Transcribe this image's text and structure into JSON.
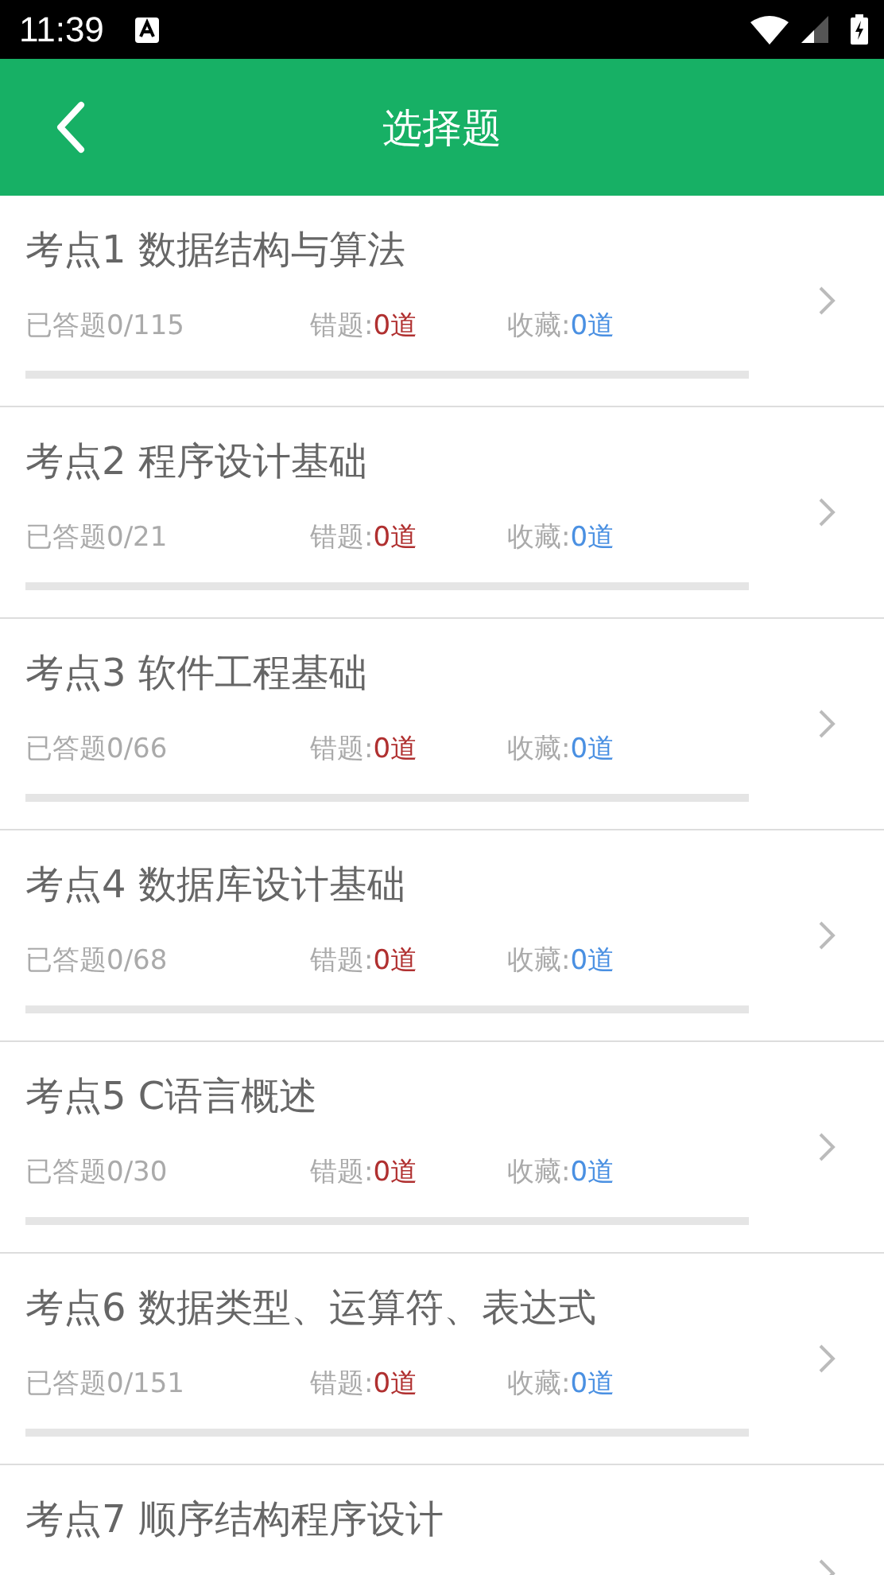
{
  "status_bar": {
    "time": "11:39"
  },
  "header": {
    "title": "选择题"
  },
  "topics": [
    {
      "title": "考点1 数据结构与算法",
      "answered": "已答题0/115",
      "wrong_label": "错题:",
      "wrong_count": "0道",
      "fav_label": "收藏:",
      "fav_count": "0道",
      "level": 0
    },
    {
      "title": "考点2 程序设计基础",
      "answered": "已答题0/21",
      "wrong_label": "错题:",
      "wrong_count": "0道",
      "fav_label": "收藏:",
      "fav_count": "0道",
      "level": 0
    },
    {
      "title": "考点3 软件工程基础",
      "answered": "已答题0/66",
      "wrong_label": "错题:",
      "wrong_count": "0道",
      "fav_label": "收藏:",
      "fav_count": "0道",
      "level": 0
    },
    {
      "title": "考点4 数据库设计基础",
      "answered": "已答题0/68",
      "wrong_label": "错题:",
      "wrong_count": "0道",
      "fav_label": "收藏:",
      "fav_count": "0道",
      "level": 0
    },
    {
      "title": "考点5 C语言概述",
      "answered": "已答题0/30",
      "wrong_label": "错题:",
      "wrong_count": "0道",
      "fav_label": "收藏:",
      "fav_count": "0道",
      "level": 0
    },
    {
      "title": "考点6 数据类型、运算符、表达式",
      "answered": "已答题0/151",
      "wrong_label": "错题:",
      "wrong_count": "0道",
      "fav_label": "收藏:",
      "fav_count": "0道",
      "level": 0
    },
    {
      "title": "考点7 顺序结构程序设计"
    }
  ]
}
